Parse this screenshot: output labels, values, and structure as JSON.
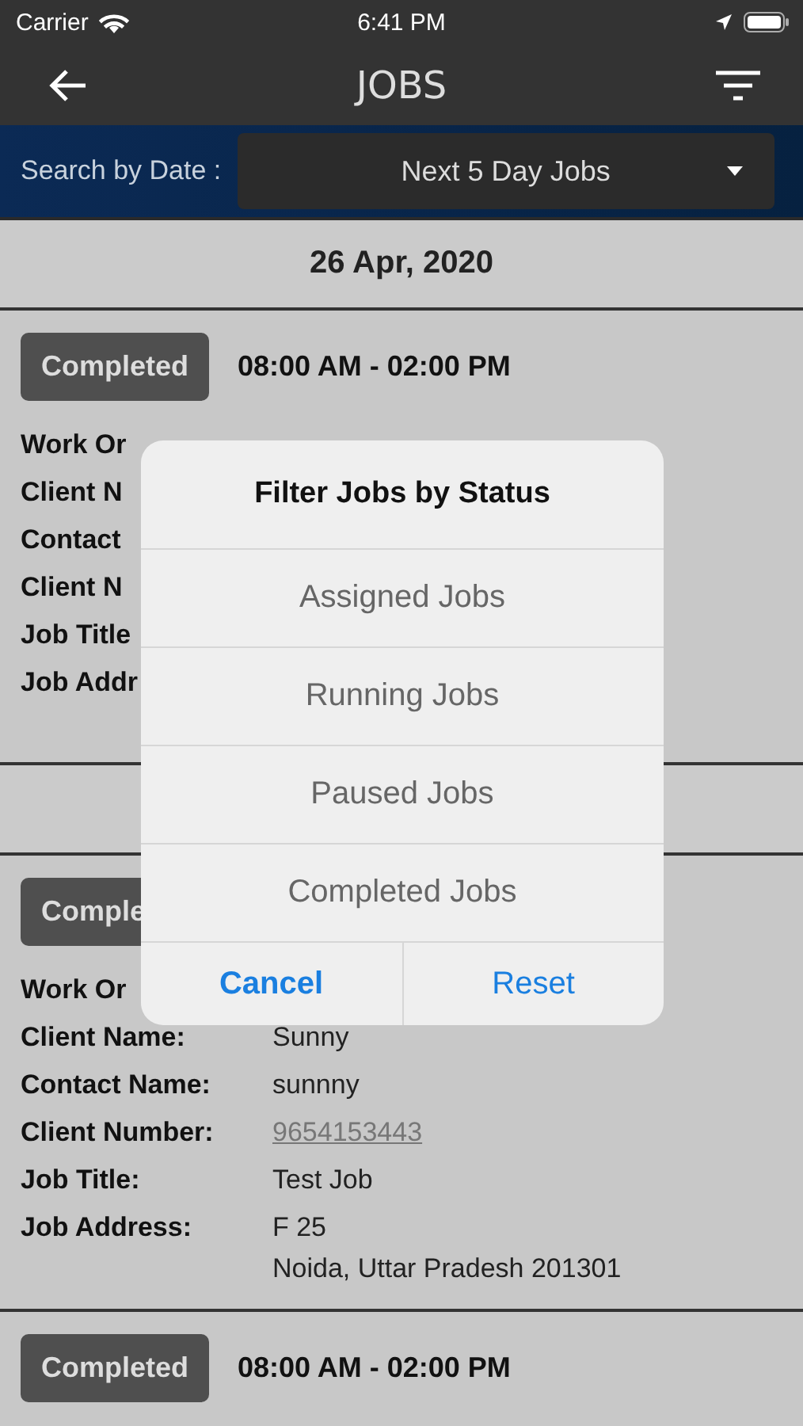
{
  "status_bar": {
    "carrier": "Carrier",
    "time": "6:41 PM"
  },
  "nav": {
    "title": "JOBS"
  },
  "search": {
    "label": "Search by Date :",
    "value": "Next 5 Day Jobs"
  },
  "feed": [
    {
      "kind": "date",
      "text": "26 Apr, 2020"
    },
    {
      "kind": "job",
      "status": "Completed",
      "time": "08:00 AM - 02:00 PM",
      "fields": [
        {
          "label": "Work Or"
        },
        {
          "label": "Client N"
        },
        {
          "label": "Contact"
        },
        {
          "label": "Client N"
        },
        {
          "label": "Job Title"
        },
        {
          "label": "Job Addr"
        }
      ]
    },
    {
      "kind": "date"
    },
    {
      "kind": "job",
      "status": "Comple",
      "fields": [
        {
          "label": "Work Or"
        },
        {
          "label": "Client Name:",
          "value": "Sunny",
          "kind": "text"
        },
        {
          "label": "Contact Name:",
          "value": "sunnny",
          "kind": "text"
        },
        {
          "label": "Client Number:",
          "value": "9654153443",
          "kind": "link"
        },
        {
          "label": "Job Title:",
          "value": "Test Job",
          "kind": "text"
        },
        {
          "label": "Job Address:",
          "lines": [
            "F 25",
            "Noida, Uttar Pradesh 201301"
          ],
          "kind": "address"
        }
      ]
    },
    {
      "kind": "job",
      "status": "Completed",
      "time": "08:00 AM - 02:00 PM"
    }
  ],
  "dialog": {
    "title": "Filter Jobs by Status",
    "options": [
      "Assigned Jobs",
      "Running Jobs",
      "Paused Jobs",
      "Completed Jobs"
    ],
    "buttons": [
      {
        "label": "Cancel",
        "kind": "cancel"
      },
      {
        "label": "Reset",
        "kind": "default"
      }
    ]
  }
}
